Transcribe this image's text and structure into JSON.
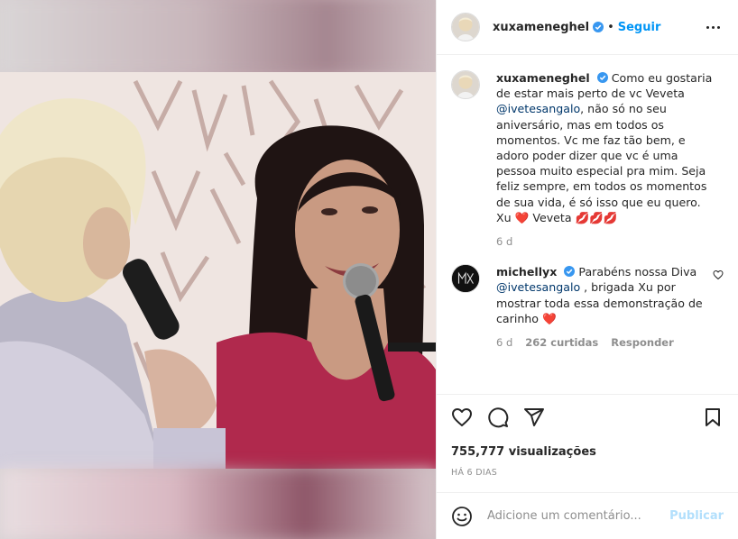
{
  "post": {
    "author": "xuxameneghel",
    "follow_label": "Seguir",
    "dot": "•",
    "caption": {
      "author": "xuxameneghel",
      "text_before_mention": "Como eu gostaria de estar mais perto de vc Veveta",
      "mention": "@ivetesangalo",
      "text_after_mention": ", não só no seu aniversário, mas em todos os momentos. Vc me faz tão bem, e adoro poder dizer que vc é uma pessoa muito especial pra mim. Seja feliz sempre, em todos os momentos de sua vida, é só isso que eu quero. Xu",
      "heart": "❤️",
      "tail": " Veveta ",
      "lips": "💋💋💋",
      "age": "6 d"
    },
    "comments": [
      {
        "author": "michellyx",
        "text_before_mention": "Parabéns nossa Diva",
        "mention": "@ivetesangalo",
        "text_after_mention": ", brigada Xu por mostrar toda essa demonstração de carinho",
        "heart": "❤️",
        "age": "6 d",
        "likes": "262 curtidas",
        "reply_label": "Responder"
      }
    ],
    "views": "755,777 visualizações",
    "date": "HÁ 6 DIAS",
    "add_comment_placeholder": "Adicione um comentário...",
    "publish_label": "Publicar"
  },
  "colors": {
    "link_blue": "#0095f6",
    "mention_blue": "#00376b",
    "heart_red": "#ed4956",
    "muted": "#8e8e8e"
  },
  "icons": [
    "verified-badge-icon",
    "more-icon",
    "like-icon",
    "comment-icon",
    "share-icon",
    "save-icon",
    "emoji-icon",
    "small-heart-icon"
  ]
}
